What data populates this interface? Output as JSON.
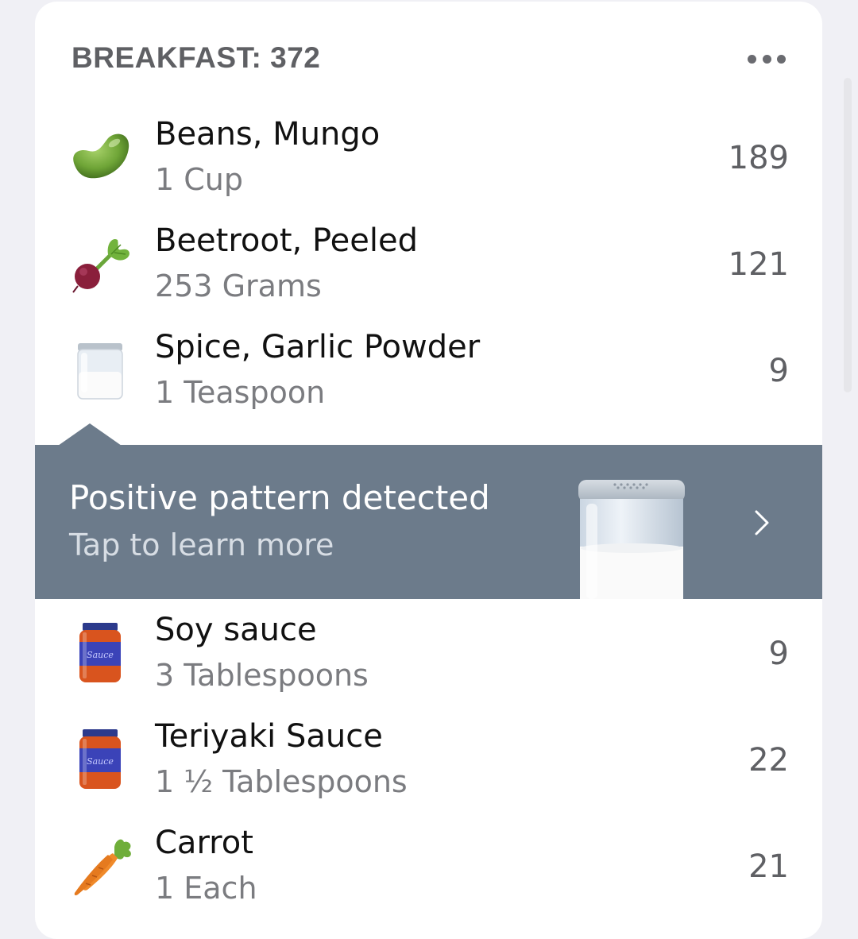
{
  "meal": {
    "title": "BREAKFAST: 372"
  },
  "items_top": [
    {
      "icon": "mung-bean-icon",
      "name": "Beans, Mungo",
      "amount": "1 Cup",
      "calories": "189"
    },
    {
      "icon": "beetroot-icon",
      "name": "Beetroot, Peeled",
      "amount": "253 Grams",
      "calories": "121"
    },
    {
      "icon": "spice-jar-icon",
      "name": "Spice, Garlic Powder",
      "amount": "1 Teaspoon",
      "calories": "9"
    }
  ],
  "banner": {
    "title": "Positive pattern detected",
    "subtitle": "Tap to learn more"
  },
  "items_bottom": [
    {
      "icon": "sauce-jar-icon",
      "name": "Soy sauce",
      "amount": "3 Tablespoons",
      "calories": "9"
    },
    {
      "icon": "sauce-jar-icon",
      "name": "Teriyaki Sauce",
      "amount": "1 ½ Tablespoons",
      "calories": "22"
    },
    {
      "icon": "carrot-icon",
      "name": "Carrot",
      "amount": "1 Each",
      "calories": "21"
    }
  ],
  "jar_label": "Sauce",
  "colors": {
    "banner_bg": "#6c7b8b",
    "card_bg": "#ffffff",
    "page_bg": "#f0f0f5"
  }
}
